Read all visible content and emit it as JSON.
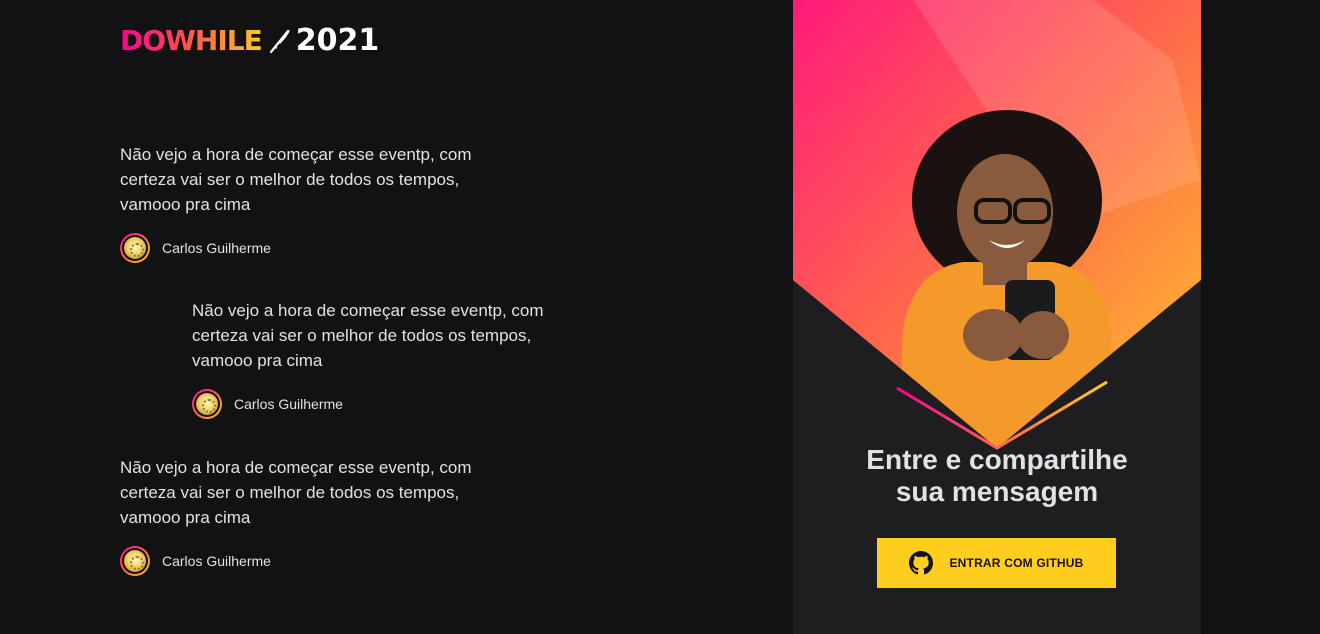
{
  "logo": {
    "word": "DOWHILE",
    "year": "2021"
  },
  "messages": [
    {
      "text": "Não vejo a hora de começar esse eventp, com certeza vai ser o melhor de todos os tempos, vamooo pra cima",
      "author": "Carlos Guilherme"
    },
    {
      "text": "Não vejo a hora de começar esse eventp, com certeza vai ser o melhor de todos os tempos, vamooo pra cima",
      "author": "Carlos Guilherme"
    },
    {
      "text": "Não vejo a hora de começar esse eventp, com certeza vai ser o melhor de todos os tempos, vamooo pra cima",
      "author": "Carlos Guilherme"
    }
  ],
  "signin": {
    "title_line1": "Entre e compartilhe",
    "title_line2": "sua mensagem",
    "button_label": "ENTRAR COM GITHUB"
  },
  "colors": {
    "background": "#121214",
    "panel": "#1e1e21",
    "accent_yellow": "#ffcd1e",
    "accent_pink": "#ff008e",
    "text": "#e1e1e6"
  },
  "icons": {
    "logo_pen": "feather-pen-icon",
    "github": "github-icon"
  }
}
